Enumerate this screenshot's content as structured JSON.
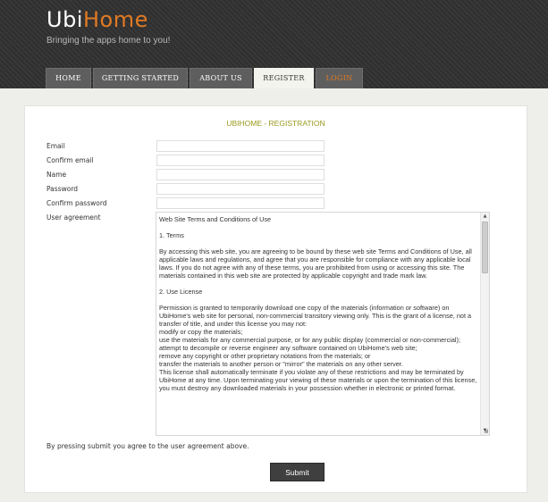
{
  "header": {
    "logo_part1": "Ubi",
    "logo_part2": "Home",
    "tagline": "Bringing the apps home to you!"
  },
  "nav": {
    "home": "HOME",
    "getting_started": "GETTING STARTED",
    "about": "ABOUT US",
    "register": "REGISTER",
    "login": "LOGIN",
    "active": "REGISTER"
  },
  "form": {
    "title": "UBIHOME - REGISTRATION",
    "email_label": "Email",
    "email_value": "",
    "confirm_email_label": "Confirm email",
    "confirm_email_value": "",
    "name_label": "Name",
    "name_value": "",
    "password_label": "Password",
    "password_value": "",
    "confirm_password_label": "Confirm password",
    "confirm_password_value": "",
    "agreement_label": "User agreement",
    "agreement": {
      "heading": "Web Site Terms and Conditions of Use",
      "section1_title": "1. Terms",
      "section1_text": "By accessing this web site, you are agreeing to be bound by these web site Terms and Conditions of Use, all applicable laws and regulations, and agree that you are responsible for compliance with any applicable local laws. If you do not agree with any of these terms, you are prohibited from using or accessing this site. The materials contained in this web site are protected by applicable copyright and trade mark law.",
      "section2_title": "2. Use License",
      "section2_text": "Permission is granted to temporarily download one copy of the materials (information or software) on UbiHome's web site for personal, non-commercial transitory viewing only. This is the grant of a license, not a transfer of title, and under this license you may not:",
      "item1": "modify or copy the materials;",
      "item2": "use the materials for any commercial purpose, or for any public display (commercial or non-commercial);",
      "item3": "attempt to decompile or reverse engineer any software contained on UbiHome's web site;",
      "item4": "remove any copyright or other proprietary notations from the materials; or",
      "item5": "transfer the materials to another person or \"mirror\" the materials on any other server.",
      "termination": "This license shall automatically terminate if you violate any of these restrictions and may be terminated by UbiHome at any time. Upon terminating your viewing of these materials or upon the termination of this license, you must destroy any downloaded materials in your possession whether in electronic or printed format."
    },
    "notice": "By pressing submit you agree to the user agreement above.",
    "submit_label": "Submit"
  },
  "colors": {
    "brand_accent": "#e07a24",
    "title_color": "#9a9a1e",
    "header_bg": "#333333",
    "button_bg": "#3f3f3f"
  }
}
